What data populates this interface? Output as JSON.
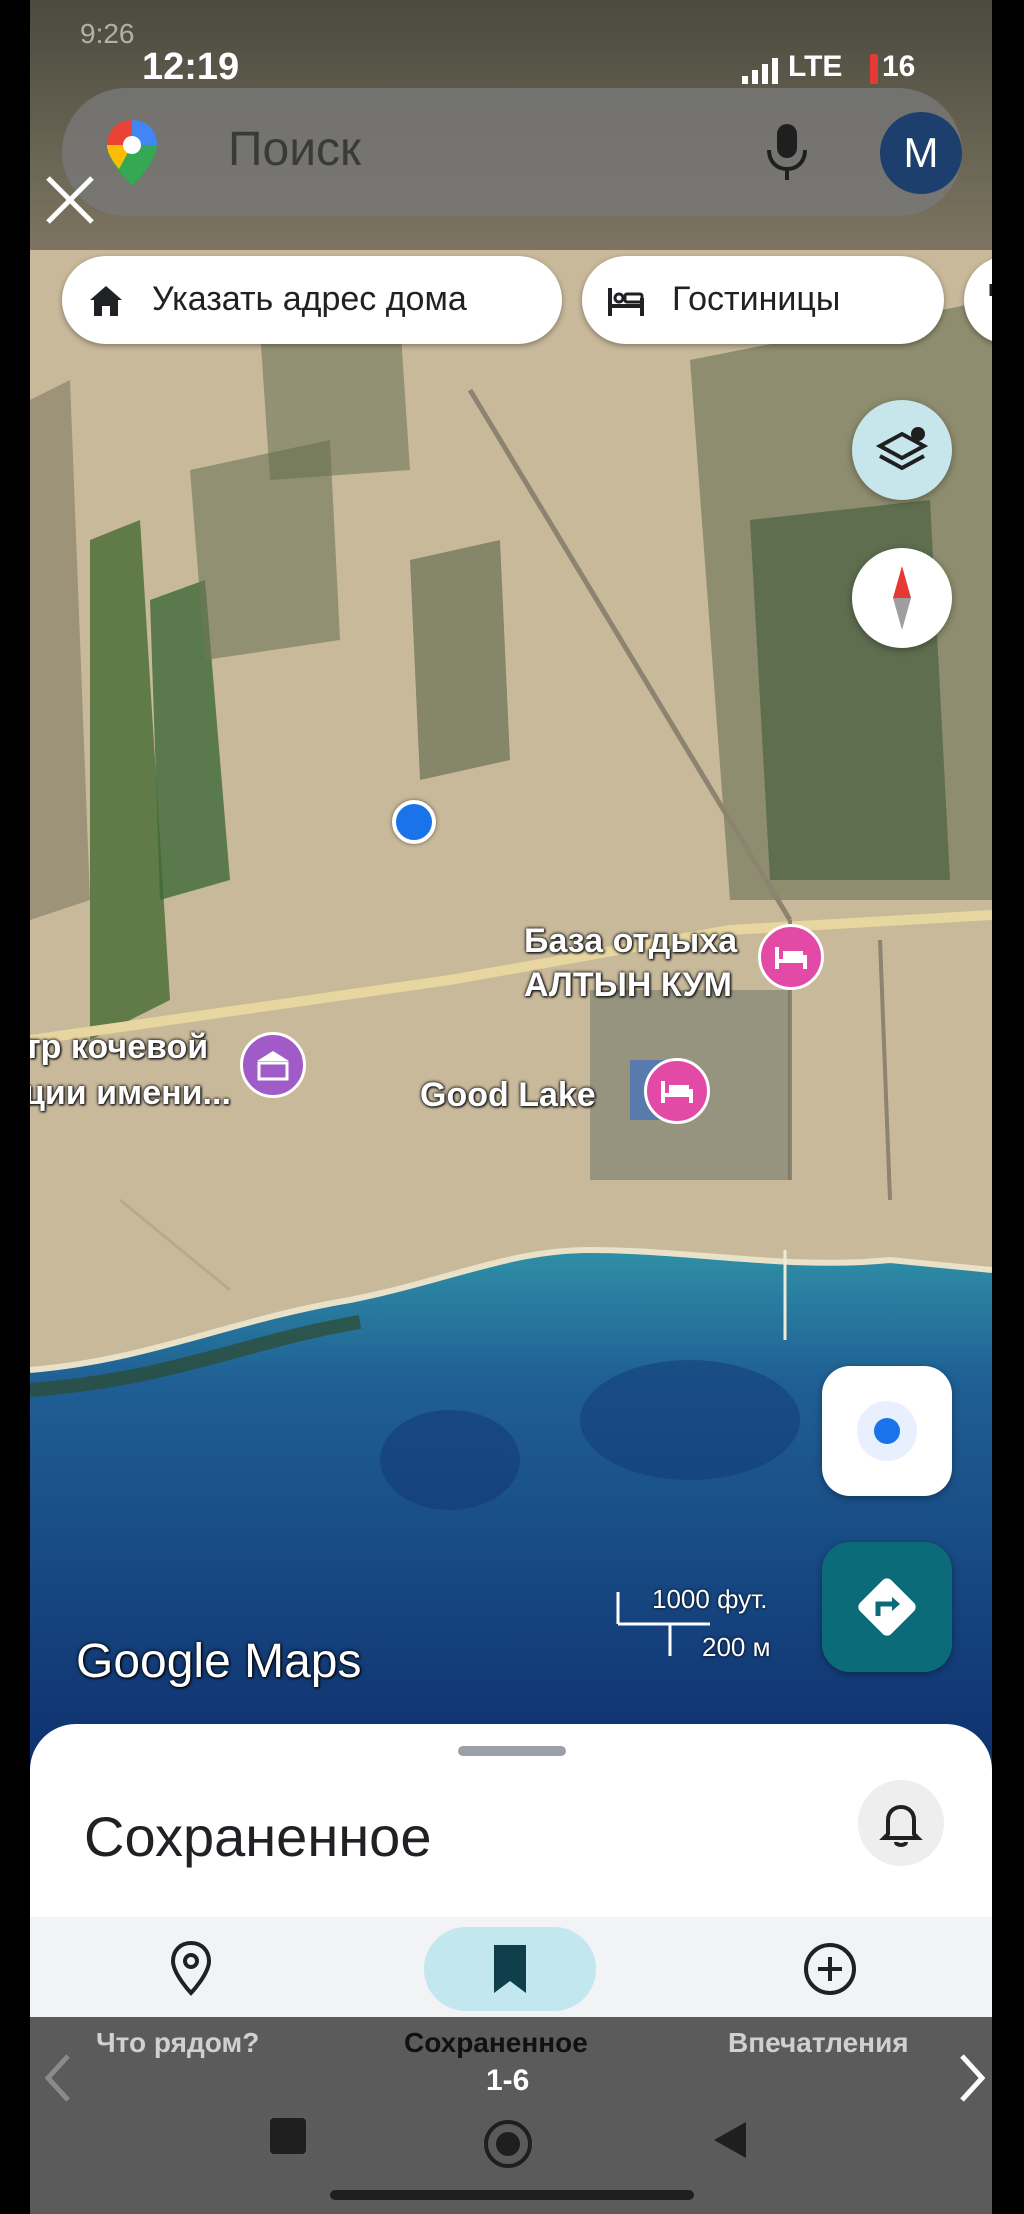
{
  "status_bar": {
    "time_back": "9:26",
    "time": "12:19",
    "network": "LTE",
    "battery": "16"
  },
  "search": {
    "placeholder": "Поиск",
    "avatar_letter": "M"
  },
  "chips": [
    {
      "label": "Указать адрес дома",
      "icon": "home-icon"
    },
    {
      "label": "Гостиницы",
      "icon": "hotel-icon"
    },
    {
      "label": "",
      "icon": "restaurant-icon"
    }
  ],
  "map_labels": {
    "resort_line1": "База отдыха",
    "resort_line2": "АЛТЫН КУМ",
    "center_line1": "тр кочевой",
    "center_line2": "ции имени...",
    "good_lake": "Good Lake"
  },
  "scale": {
    "imperial": "1000 фут.",
    "metric": "200 м"
  },
  "brand": "Google Maps",
  "sheet": {
    "title": "Сохраненное"
  },
  "bottom_nav": [
    {
      "label": "Что рядом?",
      "icon": "location-pin-icon",
      "active": false
    },
    {
      "label": "Сохраненное",
      "icon": "bookmark-icon",
      "active": true
    },
    {
      "label": "Впечатления",
      "icon": "add-circle-icon",
      "active": false
    }
  ],
  "pager": {
    "count": "1-6"
  },
  "colors": {
    "accent": "#0b6b78",
    "poi": "#e34aa6",
    "nav_active": "#c2e7ee",
    "location_dot": "#1a73e8"
  }
}
